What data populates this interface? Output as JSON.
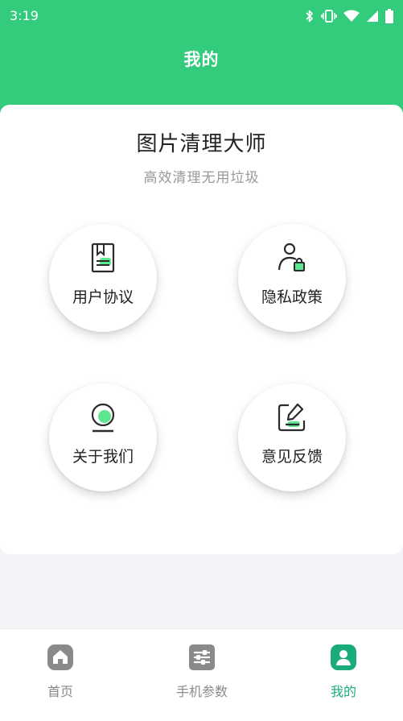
{
  "status_bar": {
    "time": "3:19"
  },
  "header": {
    "title": "我的"
  },
  "app": {
    "name": "图片清理大师",
    "slogan": "高效清理无用垃圾"
  },
  "menu": [
    {
      "label": "用户协议",
      "icon": "document-icon"
    },
    {
      "label": "隐私政策",
      "icon": "user-lock-icon"
    },
    {
      "label": "关于我们",
      "icon": "info-circle-icon"
    },
    {
      "label": "意见反馈",
      "icon": "edit-feedback-icon"
    }
  ],
  "bottom_nav": [
    {
      "label": "首页",
      "icon": "home-icon",
      "active": false
    },
    {
      "label": "手机参数",
      "icon": "sliders-icon",
      "active": false
    },
    {
      "label": "我的",
      "icon": "profile-icon",
      "active": true
    }
  ],
  "colors": {
    "brand_green": "#33cc7d",
    "icon_green": "#5ce68f",
    "active_tab": "#1aab7a",
    "inactive_tab": "#8a8a8a",
    "text_dark": "#222222",
    "text_muted": "#999999",
    "background": "#f4f4f8"
  }
}
